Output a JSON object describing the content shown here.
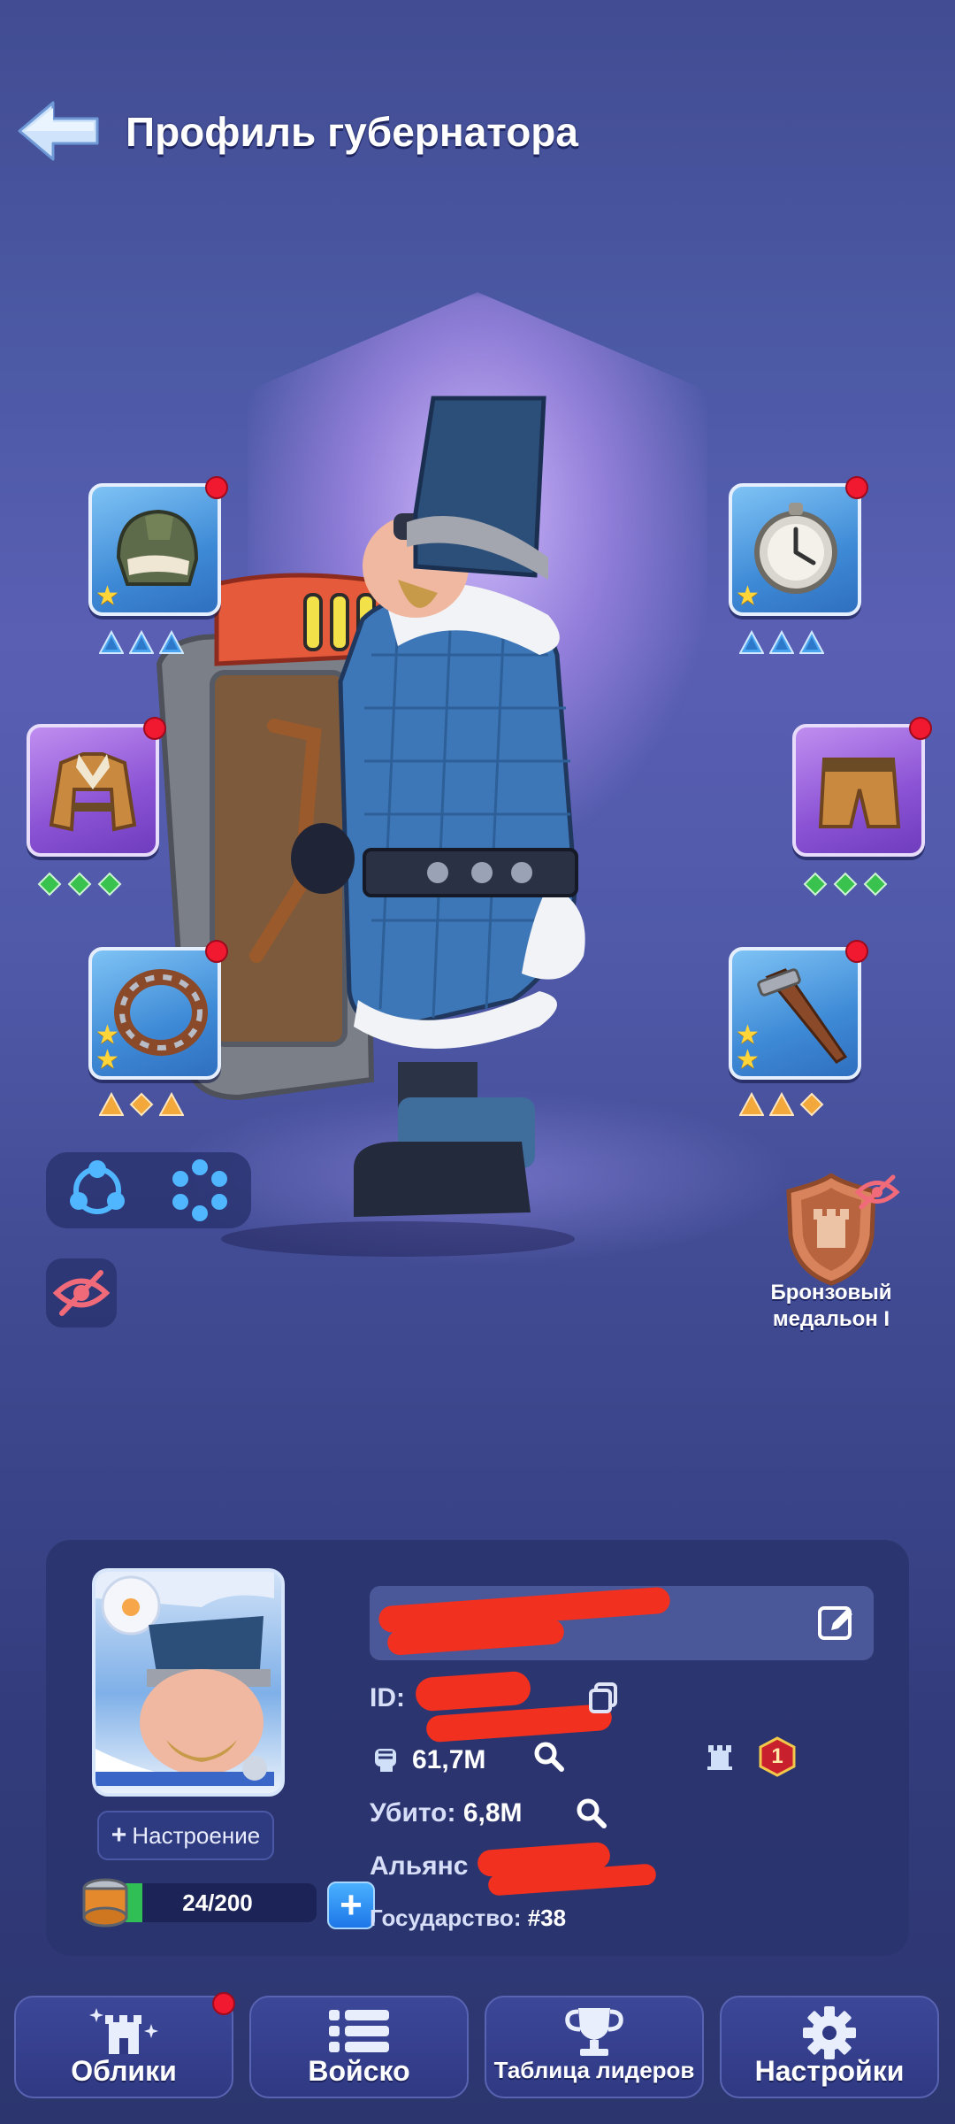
{
  "header": {
    "title": "Профиль губернатора"
  },
  "equipment": {
    "left": [
      {
        "name": "helmet",
        "stars": 1,
        "gem_color": "#4aa3f0"
      },
      {
        "name": "coat",
        "stars": 0,
        "gem_color": "#39c24d"
      },
      {
        "name": "ring",
        "stars": 2,
        "gem_color": "#f3a83b"
      }
    ],
    "right": [
      {
        "name": "pocket-watch",
        "stars": 1,
        "gem_color": "#4aa3f0"
      },
      {
        "name": "trousers",
        "stars": 0,
        "gem_color": "#39c24d"
      },
      {
        "name": "dagger",
        "stars": 2,
        "gem_color": "#f3a83b"
      }
    ]
  },
  "medal": {
    "label_line1": "Бронзовый",
    "label_line2": "медальон I"
  },
  "profile": {
    "name_value": "W",
    "id_label": "ID:",
    "power_value": "61,7M",
    "kills_label": "Убито:",
    "kills_value": "6,8M",
    "alliance_label": "Альянс",
    "state_label": "Государство:",
    "state_value": "#38",
    "mood_button": "Настроение",
    "mood_plus": "+",
    "stamina_value": "24/200",
    "stamina_fraction": 0.12,
    "stamina_add": "+",
    "rank_badge": "1"
  },
  "nav": {
    "skins": "Облики",
    "troops": "Войско",
    "leaderboard": "Таблица лидеров",
    "settings": "Настройки"
  },
  "colors": {
    "alert": "#f0192f",
    "accent_blue": "#1d76e8"
  }
}
